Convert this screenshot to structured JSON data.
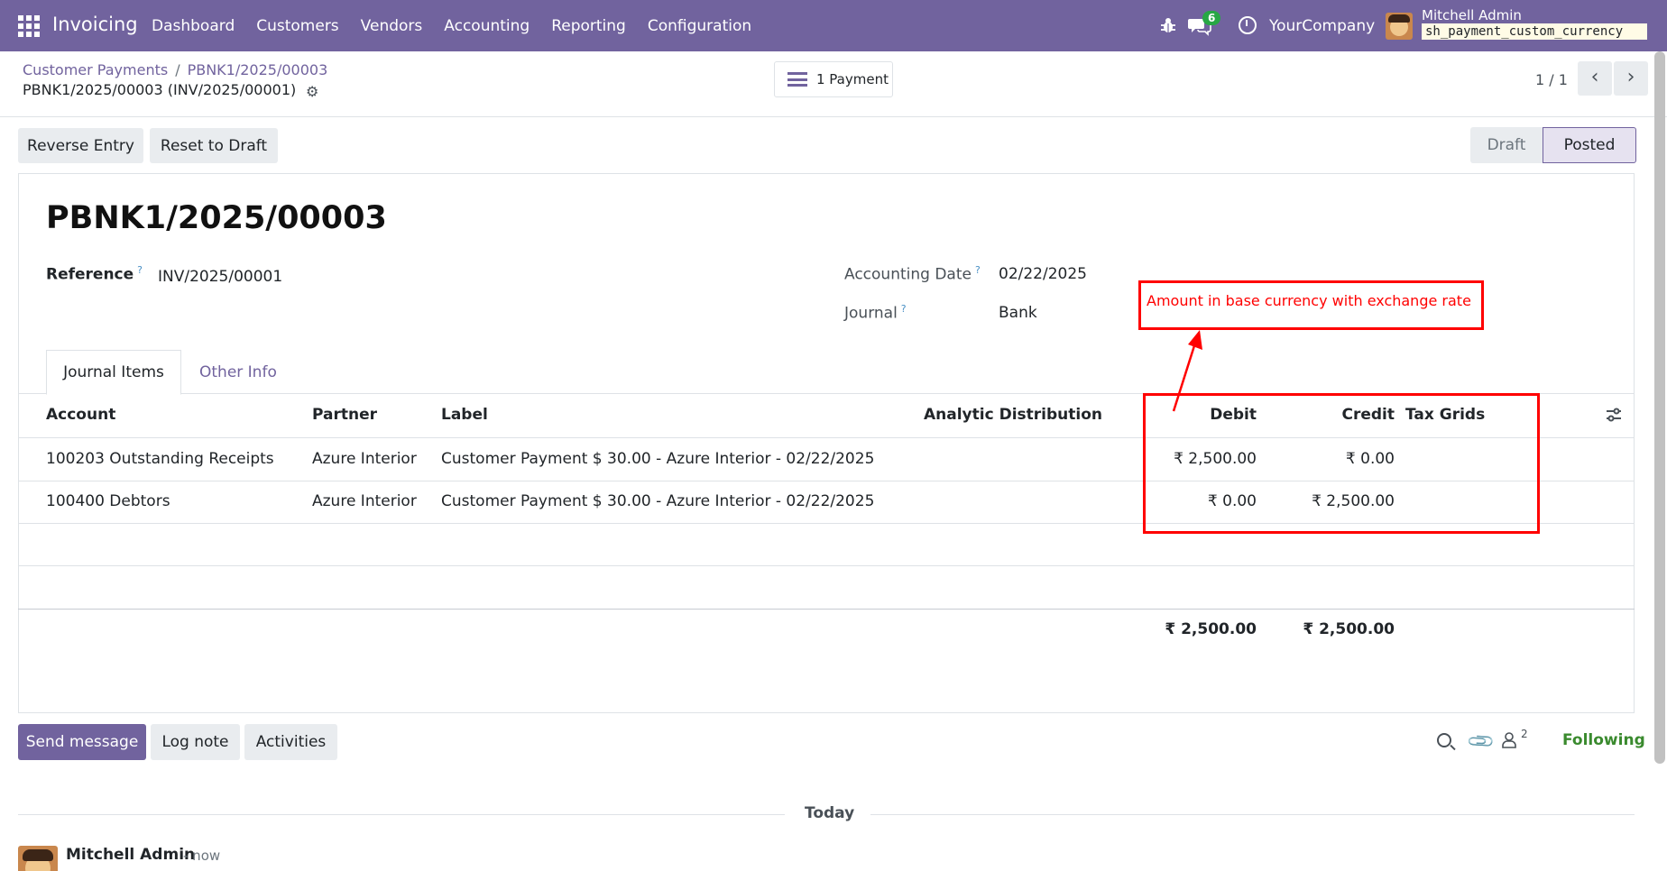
{
  "navbar": {
    "brand": "Invoicing",
    "menu": [
      "Dashboard",
      "Customers",
      "Vendors",
      "Accounting",
      "Reporting",
      "Configuration"
    ],
    "chat_count": "6",
    "company": "YourCompany",
    "user": "Mitchell Admin",
    "database": "sh_payment_custom_currency"
  },
  "breadcrumb": {
    "parent": "Customer Payments",
    "current": "PBNK1/2025/00003",
    "record": "PBNK1/2025/00003 (INV/2025/00001)"
  },
  "smart_button": {
    "label": "1 Payment"
  },
  "pager": {
    "text": "1 / 1"
  },
  "actions": {
    "reverse": "Reverse Entry",
    "reset": "Reset to Draft"
  },
  "status": {
    "draft": "Draft",
    "posted": "Posted",
    "current": "Posted"
  },
  "form": {
    "title": "PBNK1/2025/00003",
    "reference_label": "Reference",
    "reference_value": "INV/2025/00001",
    "date_label": "Accounting Date",
    "date_value": "02/22/2025",
    "journal_label": "Journal",
    "journal_value": "Bank",
    "help_mark": "?"
  },
  "tabs": {
    "journal_items": "Journal Items",
    "other_info": "Other Info"
  },
  "table": {
    "headers": {
      "account": "Account",
      "partner": "Partner",
      "label": "Label",
      "analytic": "Analytic Distribution",
      "debit": "Debit",
      "credit": "Credit",
      "tax_grids": "Tax Grids"
    },
    "rows": [
      {
        "account": "100203 Outstanding Receipts",
        "partner": "Azure Interior",
        "label": "Customer Payment $ 30.00 - Azure Interior - 02/22/2025",
        "debit": "₹ 2,500.00",
        "credit": "₹ 0.00"
      },
      {
        "account": "100400 Debtors",
        "partner": "Azure Interior",
        "label": "Customer Payment $ 30.00 - Azure Interior - 02/22/2025",
        "debit": "₹ 0.00",
        "credit": "₹ 2,500.00"
      }
    ],
    "totals": {
      "debit": "₹ 2,500.00",
      "credit": "₹ 2,500.00"
    }
  },
  "annotation": {
    "text": "Amount in base currency with exchange rate",
    "color": "#ff0000"
  },
  "chatter": {
    "send": "Send message",
    "log": "Log note",
    "activities": "Activities",
    "follower_count": "2",
    "following": "Following",
    "today": "Today",
    "author": "Mitchell Admin",
    "time": "- now"
  },
  "colors": {
    "primary": "#71639e",
    "success": "#3a8a2e"
  }
}
